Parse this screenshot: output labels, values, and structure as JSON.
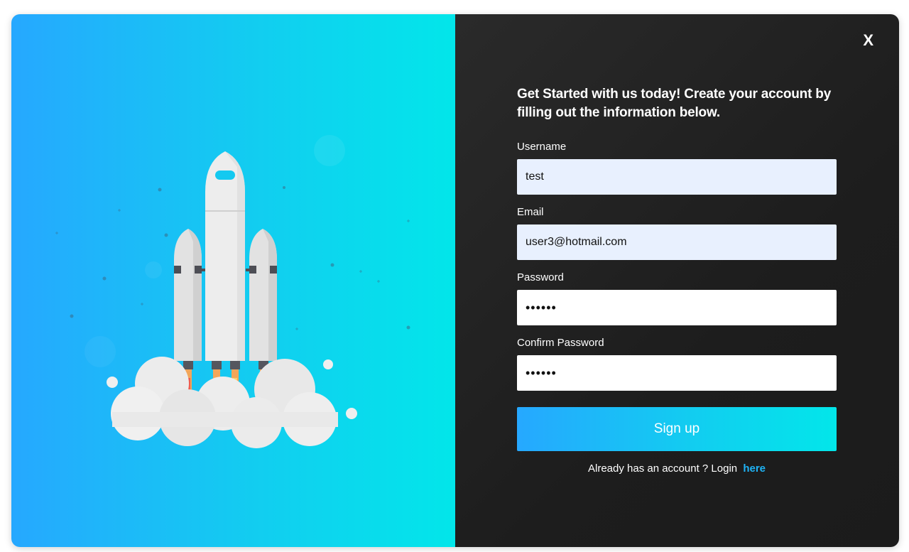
{
  "modal": {
    "close_label": "X",
    "intro": "Get Started with us today! Create your account by filling out the information below.",
    "fields": [
      {
        "label": "Username",
        "value": "test",
        "type": "text"
      },
      {
        "label": "Email",
        "value": "user3@hotmail.com",
        "type": "email"
      },
      {
        "label": "Password",
        "value": "••••••",
        "type": "password"
      },
      {
        "label": "Confirm Password",
        "value": "••••••",
        "type": "password"
      }
    ],
    "signup_label": "Sign up",
    "login_prompt": "Already has an account ? Login",
    "login_link": "here"
  },
  "colors": {
    "accent_start": "#26a8ff",
    "accent_end": "#02e6ea",
    "dark_panel": "#1d1d1d",
    "link": "#1fb3f5"
  },
  "illustration": "rocket-launch"
}
